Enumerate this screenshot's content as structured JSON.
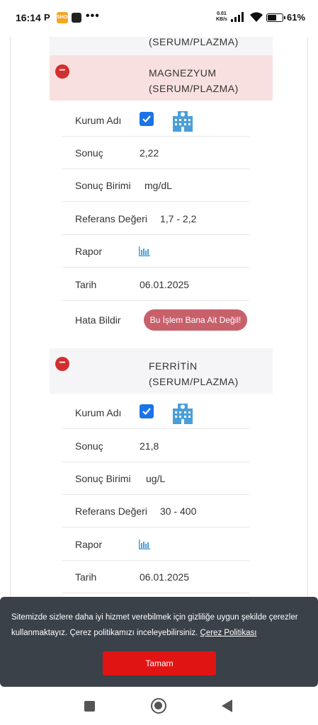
{
  "status_bar": {
    "time": "16:14",
    "app_p": "P",
    "app_shop": "SHOP",
    "dots": "•••",
    "net_speed_value": "0.01",
    "net_speed_unit": "KB/s",
    "battery_percent": "61%",
    "battery_level": 0.61
  },
  "tests": [
    {
      "name_line1": "",
      "name_line2": "(SERUM/PLAZMA)"
    },
    {
      "name_line1": "MAGNEZYUM",
      "name_line2": "(SERUM/PLAZMA)",
      "fields": {
        "kurum_label": "Kurum Adı",
        "sonuc_label": "Sonuç",
        "sonuc_value": "2,22",
        "birim_label": "Sonuç Birimi",
        "birim_value": "mg/dL",
        "referans_label": "Referans Değeri",
        "referans_value": "1,7 - 2,2",
        "rapor_label": "Rapor",
        "tarih_label": "Tarih",
        "tarih_value": "06.01.2025",
        "hata_label": "Hata Bildir",
        "hata_button": "Bu İşlem Bana Ait Değil!"
      }
    },
    {
      "name_line1": "FERRİTİN",
      "name_line2": "(SERUM/PLAZMA)",
      "fields": {
        "kurum_label": "Kurum Adı",
        "sonuc_label": "Sonuç",
        "sonuc_value": "21,8",
        "birim_label": "Sonuç Birimi",
        "birim_value": "ug/L",
        "referans_label": "Referans Değeri",
        "referans_value": "30 - 400",
        "rapor_label": "Rapor",
        "tarih_label": "Tarih",
        "tarih_value": "06.01.2025"
      }
    }
  ],
  "cookie": {
    "text": "Sitemizde sizlere daha iyi hizmet verebilmek için gizliliğe uygun şekilde çerezler kullanmaktayız. Çerez politikamızı inceleyebilirsiniz.",
    "link": "Çerez Politikası",
    "button": "Tamam"
  },
  "colors": {
    "remove_button": "#d32f2f",
    "checkbox": "#1a73e8",
    "error_button": "#c8606a",
    "cookie_bg": "#3b4149",
    "cookie_button": "#e11414",
    "icon_blue": "#4a9fd8"
  },
  "icons": {
    "building": "building-icon",
    "report": "bar-chart-icon",
    "remove": "minus-circle-icon"
  }
}
